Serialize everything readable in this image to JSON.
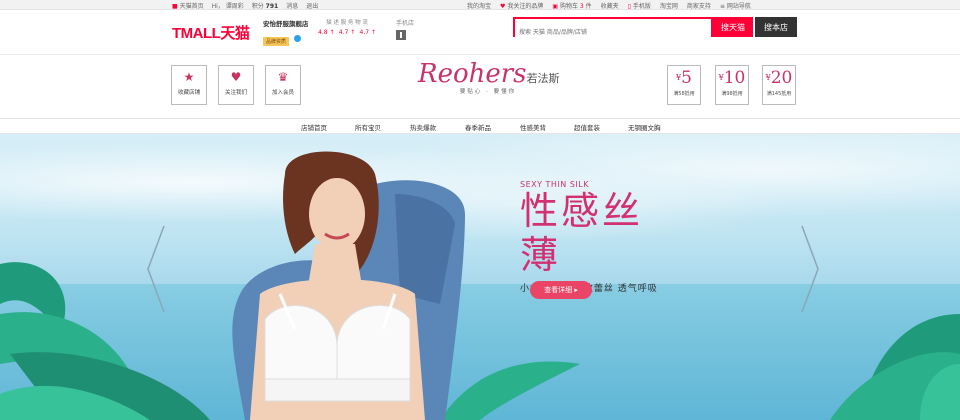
{
  "topbar": {
    "home": "天猫首页",
    "greeting": "Hi，",
    "user": "谭周彩",
    "points_label": "积分",
    "points_value": "791",
    "messages": "消息",
    "logout": "退出",
    "my_taobao": "我的淘宝",
    "favorites_brands": "我关注的品牌",
    "cart_label": "购物车",
    "cart_count": "3",
    "cart_unit": "件",
    "favorites": "收藏夹",
    "mobile": "手机版",
    "taobao": "淘宝网",
    "merchant_support": "商家支持",
    "sitemap": "网站导航"
  },
  "header": {
    "logo": "TMALL天猫",
    "shop_name": "安怡舒服旗舰店",
    "shop_badge": "品牌资质",
    "ratings_label": "描 述 服 务 物 流",
    "ratings": [
      "4.8 ↑",
      "4.7 ↑",
      "4.7 ↑"
    ],
    "mobile_shop": "手机店",
    "search_placeholder": "搜索 天猫 商品/品牌/店铺",
    "btn_search_tmall": "搜天猫",
    "btn_search_shop": "搜本店"
  },
  "shop": {
    "actions": [
      {
        "label": "收藏店铺",
        "icon": "★"
      },
      {
        "label": "关注我们",
        "icon": "♥"
      },
      {
        "label": "加入会员",
        "icon": "♛"
      }
    ],
    "brand_logo": "Reohers",
    "brand_logo_zh": "若法斯",
    "brand_tagline": "要贴心 · 要懂你",
    "coupons": [
      {
        "amount": "5",
        "cond": "满58抵用"
      },
      {
        "amount": "10",
        "cond": "满98抵用"
      },
      {
        "amount": "20",
        "cond": "满145抵用"
      }
    ]
  },
  "nav": {
    "items": [
      "店铺首页",
      "所有宝贝",
      "热卖爆款",
      "春季新品",
      "性感美背",
      "超值套装",
      "无钢圈文胸"
    ]
  },
  "hero": {
    "en_title": "SEXY THIN SILK",
    "title": "性感丝薄",
    "subtitle": "小女生最爱  精致蕾丝  透气呼吸",
    "cta": "查看详细 ▸"
  },
  "colors": {
    "accent": "#ff0036",
    "brand": "#c8336b"
  }
}
